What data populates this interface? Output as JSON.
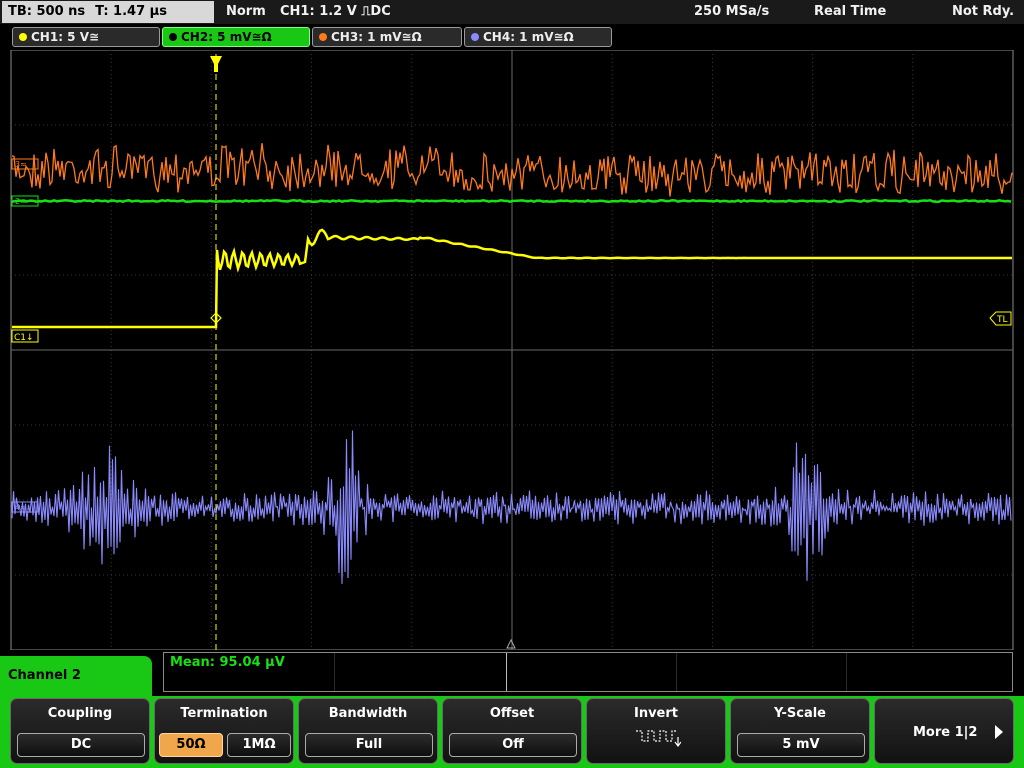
{
  "status_bar": {
    "timebase": "TB: 500 ns",
    "trigger_time": "T: 1.47 µs",
    "trigger_mode": "Norm",
    "trigger_setting": "CH1: 1.2 V ⎍DC",
    "sample_rate": "250 MSa/s",
    "acquisition": "Real Time",
    "state": "Not Rdy."
  },
  "channel_tabs": [
    {
      "label": "CH1: 5 V≅",
      "color": "#ffff00",
      "active": false
    },
    {
      "label": "CH2: 5 mV≅Ω",
      "color": "#19c814",
      "active": true
    },
    {
      "label": "CH3: 1 mV≅Ω",
      "color": "#ff7a1a",
      "active": false
    },
    {
      "label": "CH4: 1 mV≅Ω",
      "color": "#8a8aff",
      "active": false
    }
  ],
  "markers": {
    "ch1": "C1↓",
    "ch2": "2≈",
    "ch3": "3≈",
    "ch4": "4≈",
    "trigger_level": "TL"
  },
  "colors": {
    "ch1": "#ffff00",
    "ch2": "#19e014",
    "ch3": "#ff7a1a",
    "ch4": "#8a8aff",
    "grid": "#555555"
  },
  "panel": {
    "channel_label": "Channel 2",
    "measurement": "Mean: 95.04 µV"
  },
  "softkeys": {
    "coupling": {
      "title": "Coupling",
      "value": "DC"
    },
    "termination": {
      "title": "Termination",
      "opt_50": "50Ω",
      "opt_1m": "1MΩ"
    },
    "bandwidth": {
      "title": "Bandwidth",
      "value": "Full"
    },
    "offset": {
      "title": "Offset",
      "value": "Off"
    },
    "invert": {
      "title": "Invert",
      "icon": "square-wave-invert-icon"
    },
    "yscale": {
      "title": "Y-Scale",
      "value": "5 mV"
    },
    "more": {
      "label": "More 1|2"
    }
  }
}
